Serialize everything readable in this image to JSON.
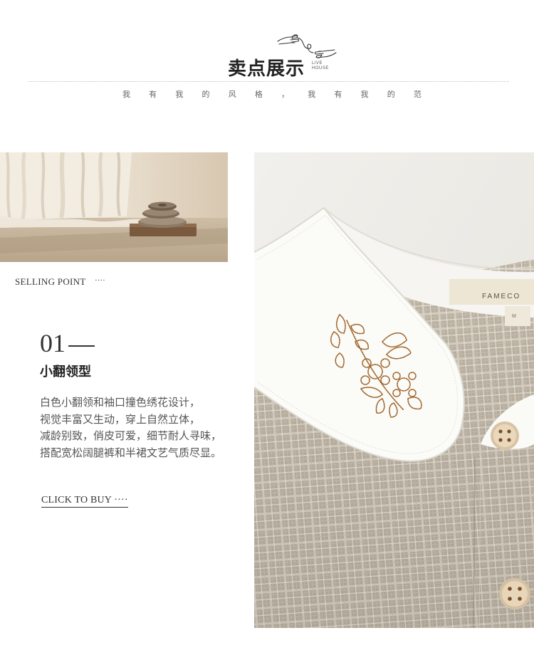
{
  "header": {
    "title": "卖点展示",
    "brand_sub_line1": "LIVE",
    "brand_sub_line2": "HOUSE",
    "slogan_chars": [
      "我",
      "有",
      "我",
      "的",
      "风",
      "格",
      "，",
      "我",
      "有",
      "我",
      "的",
      "范"
    ]
  },
  "selling": {
    "label": "SELLING POINT",
    "dots": "····",
    "number": "01",
    "title": "小翻领型",
    "description": [
      "白色小翻领和袖口撞色绣花设计，",
      "视觉丰富又生动，穿上自然立体，",
      "减龄别致，俏皮可爱，细节耐人寻味，",
      "搭配宽松阔腿裤和半裙文艺气质尽显。"
    ],
    "cta": "CLICK TO BUY ····"
  },
  "photos": {
    "left": "interior-curtain-stones-photo",
    "right": "plaid-shirt-embroidered-collar-photo",
    "label_text": "FAMECO",
    "size_text": "M"
  },
  "colors": {
    "text_dark": "#333333",
    "plaid_base": "#bcb2a2",
    "embroidery": "#a0652b",
    "collar": "#fafaf7"
  }
}
